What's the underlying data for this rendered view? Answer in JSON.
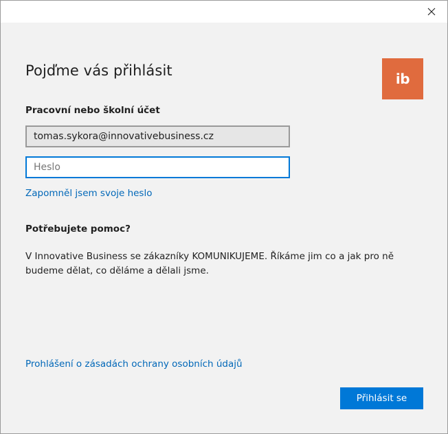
{
  "window": {
    "close_icon": "close-icon"
  },
  "signin": {
    "heading": "Pojďme vás přihlásit",
    "logo_text": "ib",
    "logo_color": "#e06b3e",
    "account_label": "Pracovní nebo školní účet",
    "email_value": "tomas.sykora@innovativebusiness.cz",
    "password_placeholder": "Heslo",
    "forgot_link": "Zapomněl jsem svoje heslo",
    "help_heading": "Potřebujete pomoc?",
    "help_text": "V Innovative Business se zákazníky KOMUNIKUJEME. Říkáme jim co a jak pro ně budeme dělat, co děláme a dělali jsme.",
    "privacy_link": "Prohlášení o zásadách ochrany osobních údajů",
    "signin_button": "Přihlásit se",
    "accent_color": "#0078d7"
  }
}
